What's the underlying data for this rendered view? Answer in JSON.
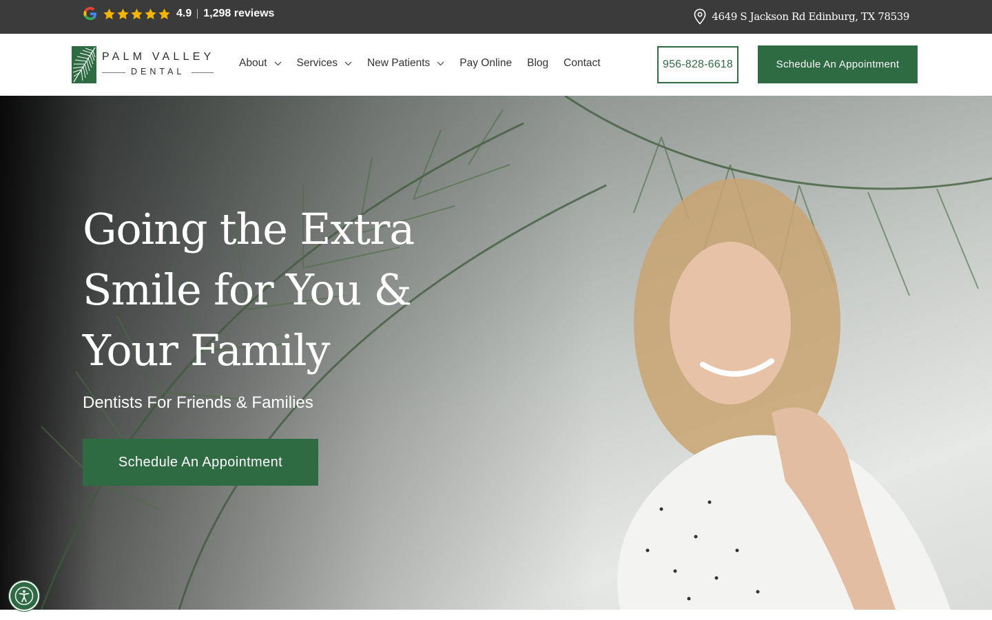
{
  "topbar": {
    "rating_score": "4.9",
    "reviews_label": "1,298 reviews",
    "star_count": 5,
    "address": "4649 S Jackson Rd Edinburg, TX 78539"
  },
  "logo": {
    "line1": "PALM VALLEY",
    "line2": "DENTAL"
  },
  "nav": {
    "items": [
      {
        "label": "About",
        "has_dropdown": true
      },
      {
        "label": "Services",
        "has_dropdown": true
      },
      {
        "label": "New Patients",
        "has_dropdown": true
      },
      {
        "label": "Pay Online",
        "has_dropdown": false
      },
      {
        "label": "Blog",
        "has_dropdown": false
      },
      {
        "label": "Contact",
        "has_dropdown": false
      }
    ]
  },
  "header": {
    "phone": "956-828-6618",
    "cta_label": "Schedule An Appointment"
  },
  "hero": {
    "title": "Going the Extra Smile for You & Your Family",
    "subtitle": "Dentists For Friends & Families",
    "cta_label": "Schedule An Appointment"
  },
  "colors": {
    "brand_green": "#2e6b43",
    "topbar_bg": "#3b3b3b",
    "star_gold": "#f4b400"
  },
  "icons": {
    "rating_logo": "google-g-icon",
    "address": "map-pin-icon",
    "accessibility": "accessibility-icon",
    "dropdown": "chevron-down-icon"
  }
}
